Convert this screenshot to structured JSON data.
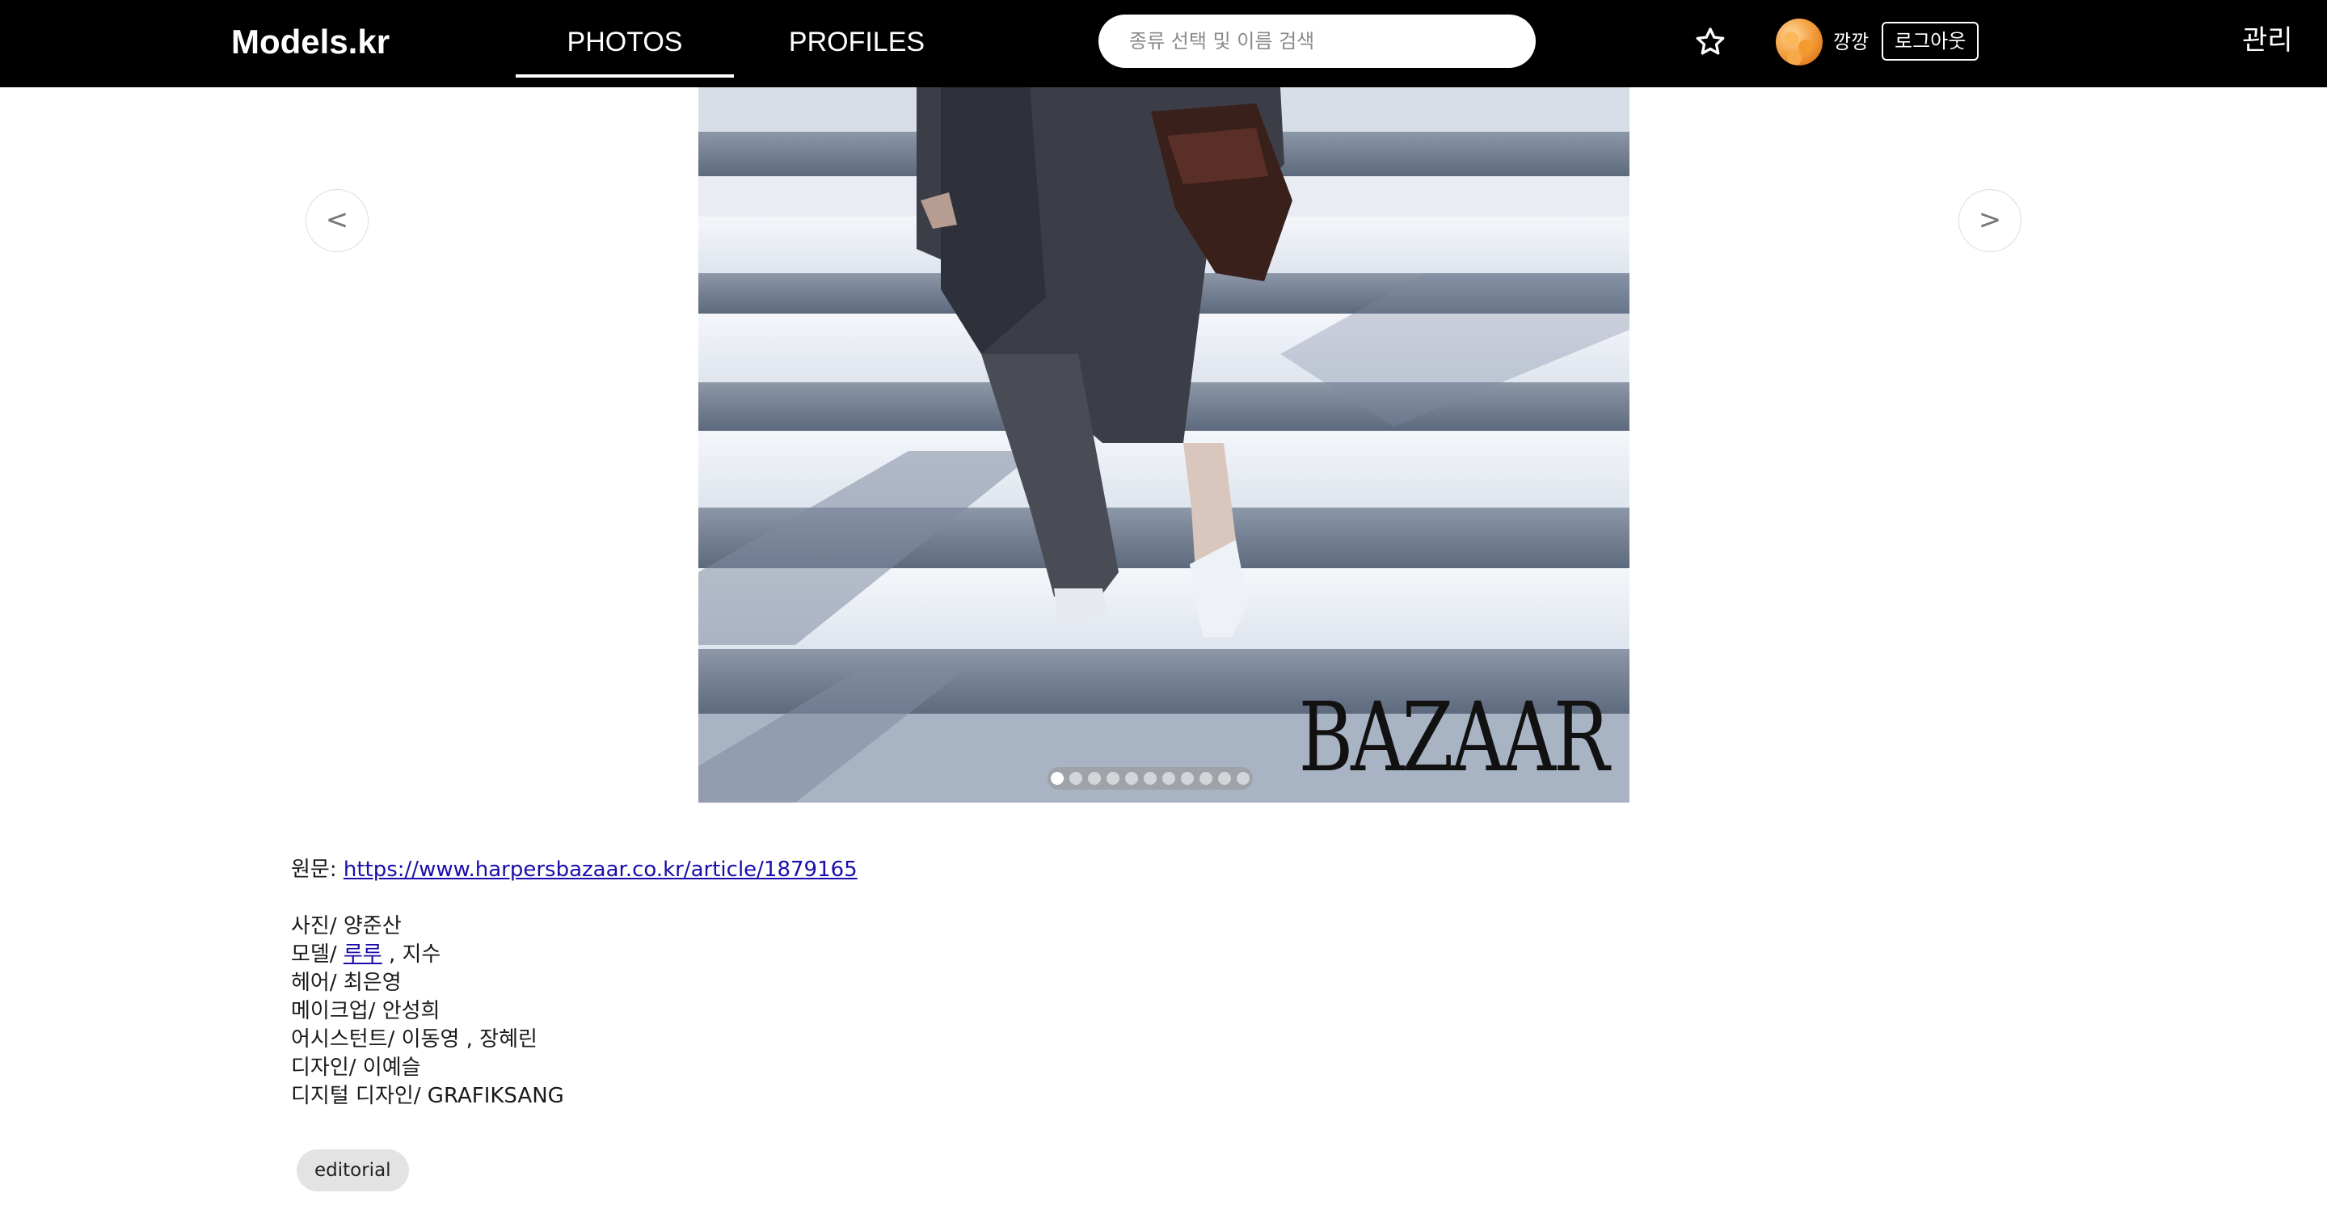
{
  "nav": {
    "logo": "Models.kr",
    "tabs": [
      {
        "label": "PHOTOS",
        "active": true
      },
      {
        "label": "PROFILES",
        "active": false
      }
    ],
    "search_placeholder": "종류 선택 및 이름 검색",
    "favorites_icon": "star-outline-icon",
    "username": "깡깡",
    "logout_label": "로그아웃",
    "admin_label": "관리"
  },
  "carousel": {
    "prev_label": "<",
    "next_label": ">",
    "brand_watermark": "BAZAAR",
    "slide_count": 11,
    "active_slide": 1
  },
  "caption": {
    "source_label": "원문:",
    "source_url": "https://www.harpersbazaar.co.kr/article/1879165",
    "credits": {
      "photo": "사진/ 양준산",
      "model_prefix": "모델/",
      "model_link": "루루",
      "model_rest": ", 지수",
      "hair": "헤어/ 최은영",
      "makeup": "메이크업/ 안성희",
      "assistant": "어시스턴트/ 이동영 , 장혜린",
      "design": "디자인/ 이예슬",
      "digital_design": "디지털 디자인/ GRAFIKSANG"
    }
  },
  "tags": [
    "editorial"
  ],
  "colors": {
    "nav_bg": "#000000",
    "link": "#1a0dab",
    "tag_bg": "#e3e3e3"
  }
}
